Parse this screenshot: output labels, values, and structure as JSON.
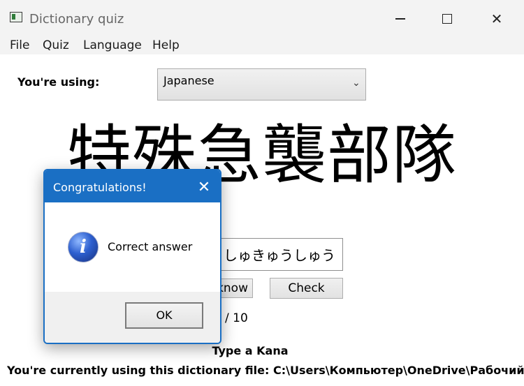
{
  "window": {
    "title": "Dictionary quiz",
    "controls": {
      "minimize": "minimize",
      "maximize": "maximize",
      "close": "✕"
    }
  },
  "menu": [
    "File",
    "Quiz",
    "Language",
    "Help"
  ],
  "language": {
    "label": "You're using:",
    "selected": "Japanese",
    "arrow": "⌄"
  },
  "quiz": {
    "word": "特殊急襲部隊",
    "answer_value": "しゅきゅうしゅう",
    "dont_know_label": "know",
    "check_label": "Check",
    "score_text": "/ 10",
    "hint": "Type a Kana",
    "dictionary_file": "You're currently using this dictionary file: C:\\Users\\Компьютер\\OneDrive\\Рабочий стол"
  },
  "dialog": {
    "title": "Congratulations!",
    "close": "✕",
    "icon": "info-icon",
    "message": "Correct answer",
    "ok_label": "OK"
  },
  "colors": {
    "dialog_accent": "#1a6fc4",
    "titlebar": "#f3f3f3"
  }
}
